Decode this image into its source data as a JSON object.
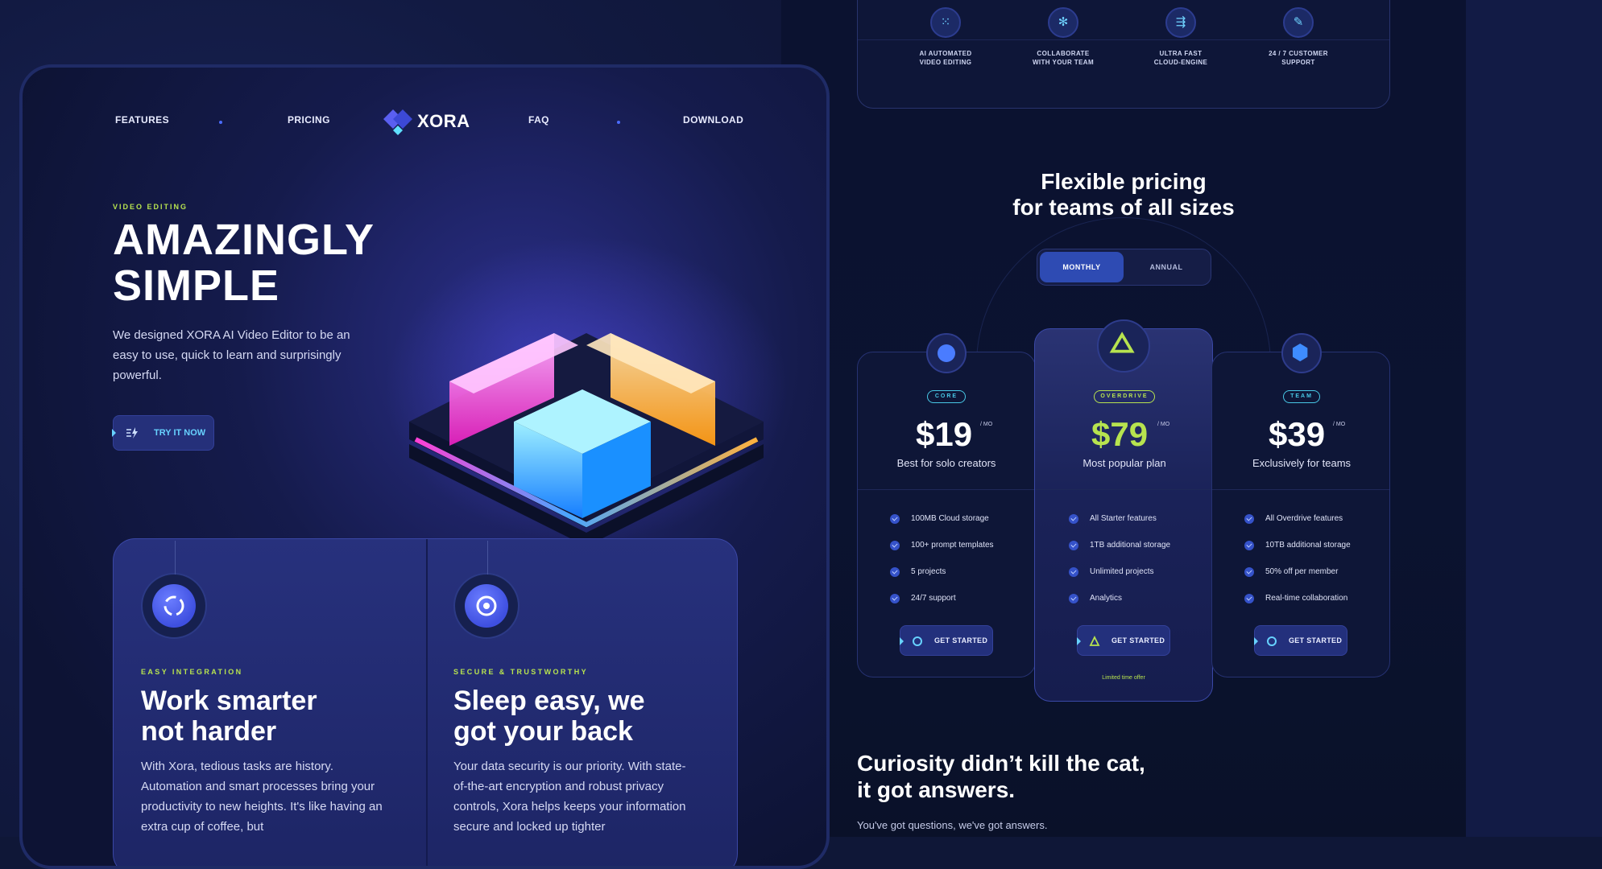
{
  "nav": {
    "features": "FEATURES",
    "pricing": "PRICING",
    "brand": "XORA",
    "faq": "FAQ",
    "download": "DOWNLOAD"
  },
  "hero": {
    "eyebrow": "VIDEO EDITING",
    "title_line1": "AMAZINGLY",
    "title_line2": "SIMPLE",
    "description": "We designed XORA AI Video Editor to be an easy to use, quick to learn and surprisingly powerful.",
    "cta": "TRY IT NOW"
  },
  "features": [
    {
      "icon": "swirl-icon",
      "eyebrow": "EASY INTEGRATION",
      "title_line1": "Work smarter",
      "title_line2": "not harder",
      "body": "With Xora, tedious tasks are history. Automation and smart processes bring your productivity to new heights. It's like having an extra cup of coffee, but"
    },
    {
      "icon": "shield-lock-icon",
      "eyebrow": "SECURE & TRUSTWORTHY",
      "title_line1": "Sleep easy, we",
      "title_line2": "got your back",
      "body": "Your data security is our priority. With state-of-the-art encryption and robust privacy controls, Xora helps keeps your information secure and locked up tighter"
    }
  ],
  "top_features": [
    {
      "icon": "dots-icon",
      "line1": "AI AUTOMATED",
      "line2": "VIDEO EDITING"
    },
    {
      "icon": "network-icon",
      "line1": "COLLABORATE",
      "line2": "WITH YOUR TEAM"
    },
    {
      "icon": "speed-arrow-icon",
      "line1": "ULTRA FAST",
      "line2": "CLOUD-ENGINE"
    },
    {
      "icon": "support-icon",
      "line1": "24 / 7 CUSTOMER",
      "line2": "SUPPORT"
    }
  ],
  "pricing": {
    "title_line1": "Flexible pricing",
    "title_line2": "for teams of all sizes",
    "toggle_monthly": "MONTHLY",
    "toggle_annual": "ANNUAL",
    "selected_period": "MONTHLY",
    "per": "/ MO",
    "plans": [
      {
        "badge": "CORE",
        "price": "$19",
        "desc": "Best for solo creators",
        "features": [
          "100MB Cloud storage",
          "100+ prompt templates",
          "5 projects",
          "24/7 support"
        ],
        "cta": "GET STARTED"
      },
      {
        "badge": "OVERDRIVE",
        "price": "$79",
        "desc": "Most popular plan",
        "features": [
          "All Starter features",
          "1TB additional storage",
          "Unlimited projects",
          "Analytics"
        ],
        "cta": "GET STARTED",
        "offer": "Limited time offer"
      },
      {
        "badge": "TEAM",
        "price": "$39",
        "desc": "Exclusively for teams",
        "features": [
          "All Overdrive features",
          "10TB additional storage",
          "50% off per member",
          "Real-time collaboration"
        ],
        "cta": "GET STARTED"
      }
    ]
  },
  "faq": {
    "title_line1": "Curiosity didn’t kill the cat,",
    "title_line2": "it got answers.",
    "subtitle": "You've got questions, we've got answers."
  },
  "colors": {
    "accent_green": "#b7e34f",
    "accent_cyan": "#67d2ff",
    "background": "#0f1737",
    "button": "#23307c"
  }
}
